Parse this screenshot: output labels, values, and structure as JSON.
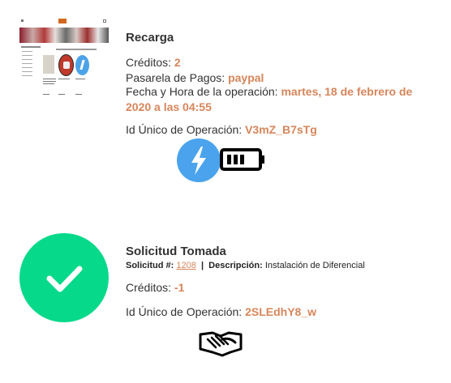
{
  "recarga": {
    "title": "Recarga",
    "creditos_label": "Créditos: ",
    "creditos_value": "2",
    "pasarela_label": "Pasarela de Pagos: ",
    "pasarela_value": "paypal",
    "fecha_label": "Fecha y Hora de la operación: ",
    "fecha_value": "martes, 18 de febrero de 2020 a las 04:55",
    "id_label": "Id Único de Operación: ",
    "id_value": "V3mZ_B7sTg",
    "icons": [
      "lightning-bolt-icon",
      "battery-icon"
    ]
  },
  "solicitud": {
    "title": "Solicitud Tomada",
    "solicitud_label": "Solicitud #:",
    "solicitud_value": "1208",
    "separator": "|",
    "descripcion_label": "Descripción:",
    "descripcion_value": "Instalación de Diferencial",
    "creditos_label": "Créditos: ",
    "creditos_value": "-1",
    "id_label": "Id Único de Operación: ",
    "id_value": "2SLEdhY8_w",
    "icons": [
      "checkmark-icon",
      "handshake-icon"
    ]
  },
  "colors": {
    "accent": "#d6855a",
    "bolt_blue": "#4aa3ec",
    "check_green": "#07d98a",
    "text": "#333333"
  }
}
